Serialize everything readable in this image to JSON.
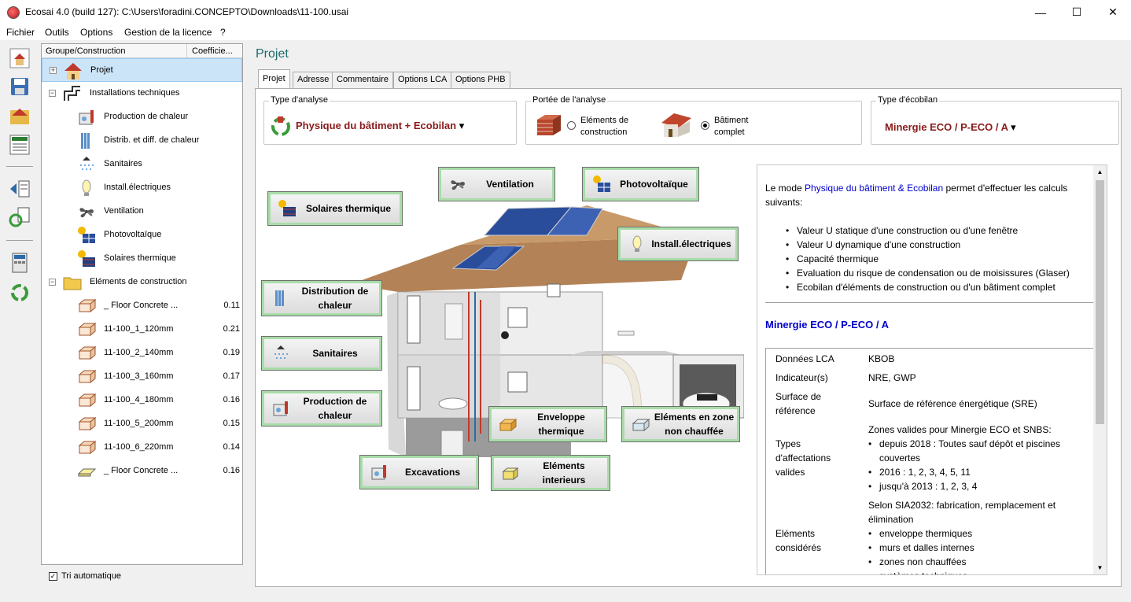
{
  "window": {
    "title": "Ecosai 4.0 (build 127): C:\\Users\\foradini.CONCEPTO\\Downloads\\11-100.usai",
    "minimize": "—",
    "maximize": "☐",
    "close": "✕"
  },
  "menu": [
    "Fichier",
    "Outils",
    "Options",
    "Gestion de la licence",
    "?"
  ],
  "tree": {
    "header_group": "Groupe/Construction",
    "header_coef": "Coefficie...",
    "items": [
      {
        "label": "Projet",
        "value": "",
        "expander": "+"
      },
      {
        "label": "Installations techniques",
        "value": "",
        "expander": "−"
      },
      {
        "label": "Production de chaleur",
        "value": ""
      },
      {
        "label": "Distrib. et diff. de chaleur",
        "value": ""
      },
      {
        "label": "Sanitaires",
        "value": ""
      },
      {
        "label": "Install.électriques",
        "value": ""
      },
      {
        "label": "Ventilation",
        "value": ""
      },
      {
        "label": "Photovoltaïque",
        "value": ""
      },
      {
        "label": "Solaires thermique",
        "value": ""
      },
      {
        "label": "Eléments de construction",
        "value": "",
        "expander": "−"
      },
      {
        "label": "_ Floor Concrete ...",
        "value": "0.11"
      },
      {
        "label": "11-100_1_120mm",
        "value": "0.21"
      },
      {
        "label": "11-100_2_140mm",
        "value": "0.19"
      },
      {
        "label": "11-100_3_160mm",
        "value": "0.17"
      },
      {
        "label": "11-100_4_180mm",
        "value": "0.16"
      },
      {
        "label": "11-100_5_200mm",
        "value": "0.15"
      },
      {
        "label": "11-100_6_220mm",
        "value": "0.14"
      },
      {
        "label": "_ Floor Concrete ...",
        "value": "0.16"
      }
    ],
    "auto_sort": "Tri automatique"
  },
  "page_title": "Projet",
  "tabs": [
    "Projet",
    "Adresse",
    "Commentaire",
    "Options LCA",
    "Options PHB"
  ],
  "analysis": {
    "legend": "Type d'analyse",
    "value": "Physique du bâtiment + Ecobilan"
  },
  "scope": {
    "legend": "Portée de l'analyse",
    "option1_line1": "Eléments de",
    "option1_line2": "construction",
    "option2_line1": "Bâtiment",
    "option2_line2": "complet",
    "selected": "Bâtiment complet"
  },
  "ecobilan": {
    "legend": "Type d'écobilan",
    "value": "Minergie ECO / P-ECO / A"
  },
  "diagram_buttons": {
    "ventilation": "Ventilation",
    "photovoltaique": "Photovoltaïque",
    "solaires": "Solaires thermique",
    "install_elec": "Install.électriques",
    "distribution_1": "Distribution de",
    "distribution_2": "chaleur",
    "sanitaires": "Sanitaires",
    "production_1": "Production de",
    "production_2": "chaleur",
    "enveloppe_1": "Enveloppe",
    "enveloppe_2": "thermique",
    "zone_1": "Eléments en zone",
    "zone_2": "non chauffée",
    "excavations": "Excavations",
    "elements_int_1": "Eléments",
    "elements_int_2": "interieurs"
  },
  "info": {
    "intro_pre": "Le mode ",
    "intro_link": "Physique du bâtiment & Ecobilan",
    "intro_post": " permet d'effectuer les calculs suivants:",
    "bullets": [
      "Valeur U statique d'une construction ou d'une fenêtre",
      "Valeur U dynamique d'une construction",
      "Capacité thermique",
      "Evaluation du risque de condensation ou de moisissures (Glaser)",
      "Ecobilan d'éléments de construction ou d'un bâtiment complet"
    ],
    "heading": "Minergie ECO / P-ECO / A",
    "table": {
      "donnees_k": "Données LCA",
      "donnees_v": "KBOB",
      "indic_k": "Indicateur(s)",
      "indic_v": "NRE, GWP",
      "surface_k1": "Surface de",
      "surface_k2": "référence",
      "surface_v": "Surface de référence énergétique (SRE)",
      "types_k1": "Types",
      "types_k2": "d'affectations",
      "types_k3": "valides",
      "types_intro": "Zones valides pour Minergie ECO et SNBS:",
      "types_b1_1": "depuis 2018 : Toutes sauf dépôt et piscines",
      "types_b1_2": "couvertes",
      "types_b2": "2016 : 1, 2, 3, 4, 5, 11",
      "types_b3": "jusqu'à 2013 : 1, 2, 3, 4",
      "elem_intro_1": "Selon SIA2032: fabrication, remplacement et",
      "elem_intro_2": "élimination",
      "elem_k1": "Eléments",
      "elem_k2": "considérés",
      "elem_b1": "enveloppe thermiques",
      "elem_b2": "murs et dalles internes",
      "elem_b3": "zones non chauffées",
      "elem_b4": "systèmes techniques"
    }
  }
}
